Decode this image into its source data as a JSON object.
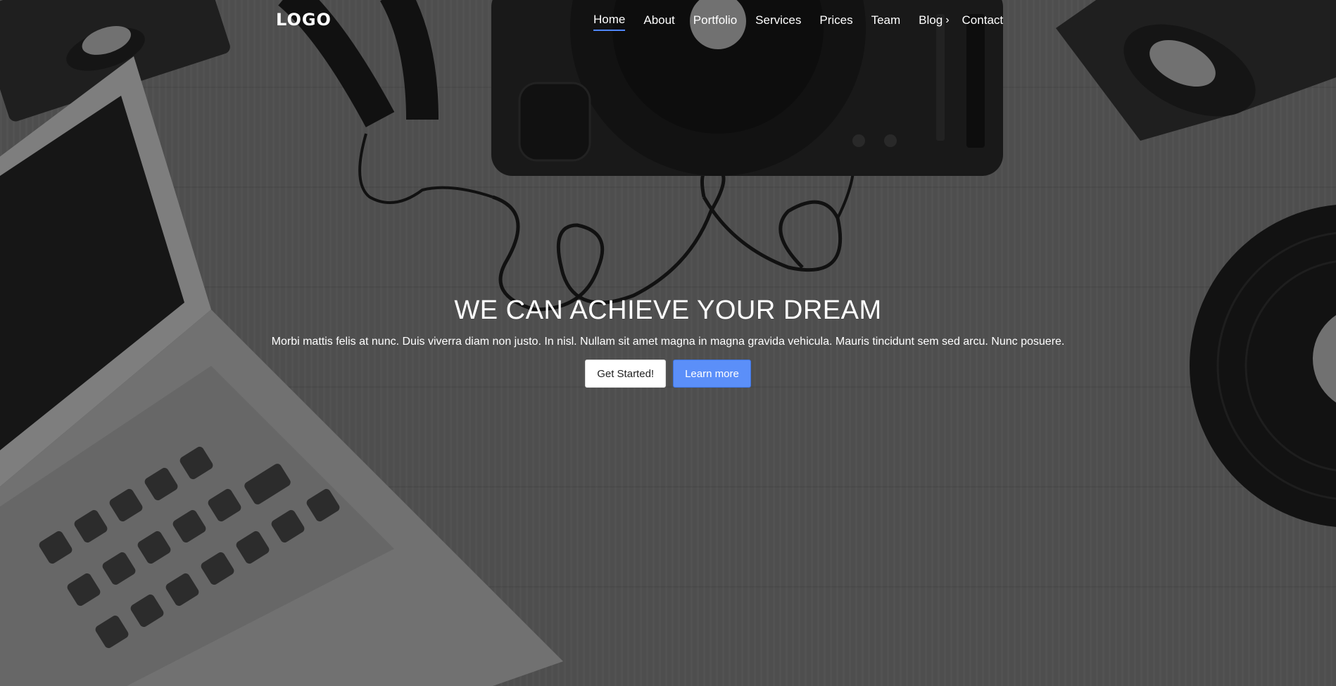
{
  "brand": {
    "logo": "LOGO"
  },
  "nav": {
    "items": [
      {
        "label": "Home",
        "active": true
      },
      {
        "label": "About"
      },
      {
        "label": "Portfolio"
      },
      {
        "label": "Services"
      },
      {
        "label": "Prices"
      },
      {
        "label": "Team"
      },
      {
        "label": "Blog",
        "icon": "chevron-right-icon"
      },
      {
        "label": "Contact"
      }
    ]
  },
  "hero": {
    "title": "WE CAN ACHIEVE YOUR DREAM",
    "text": "Morbi mattis felis at nunc. Duis viverra diam non justo. In nisl. Nullam sit amet magna in magna gravida vehicula. Mauris tincidunt sem sed arcu. Nunc posuere.",
    "buttons": {
      "primary_label": "Get Started!",
      "secondary_label": "Learn more"
    }
  },
  "colors": {
    "accent": "#4f86f7",
    "button_blue": "#5b8ff9",
    "background": "#5f5f5f"
  }
}
